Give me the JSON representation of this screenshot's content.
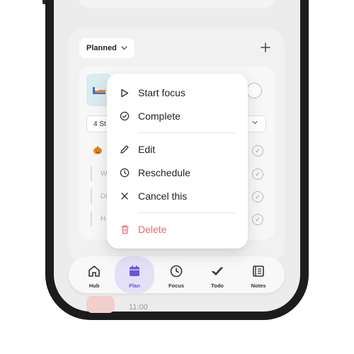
{
  "colors": {
    "accent": "#6a56d9",
    "accent_bg": "#e4e1f7",
    "danger": "#e56b6b",
    "menu_bg": "#ffffff",
    "screen_bg": "#ececed"
  },
  "planner": {
    "filter_label": "Planned",
    "filter_icon": "chevron-down-icon",
    "add_icon": "plus-icon",
    "steps_label": "4 St",
    "steps_icon": "chevron-down-icon",
    "below_time": "11:00",
    "subtask_rows": [
      {
        "text": "W"
      },
      {
        "text": "Dr"
      },
      {
        "text": "H"
      }
    ]
  },
  "context_menu": {
    "items": [
      {
        "label": "Start focus",
        "icon": "play-icon"
      },
      {
        "label": "Complete",
        "icon": "check-circle-icon"
      },
      {
        "label": "Edit",
        "icon": "pencil-icon"
      },
      {
        "label": "Reschedule",
        "icon": "clock-icon"
      },
      {
        "label": "Cancel this",
        "icon": "x-icon"
      },
      {
        "label": "Delete",
        "icon": "trash-icon",
        "danger": true
      }
    ]
  },
  "tabbar": {
    "tabs": [
      {
        "label": "Hub",
        "icon": "home-icon",
        "active": false
      },
      {
        "label": "Plan",
        "icon": "calendar-icon",
        "active": true
      },
      {
        "label": "Focus",
        "icon": "clock-icon",
        "active": false
      },
      {
        "label": "Todo",
        "icon": "check-icon",
        "active": false
      },
      {
        "label": "Notes",
        "icon": "notes-icon",
        "active": false
      }
    ]
  }
}
